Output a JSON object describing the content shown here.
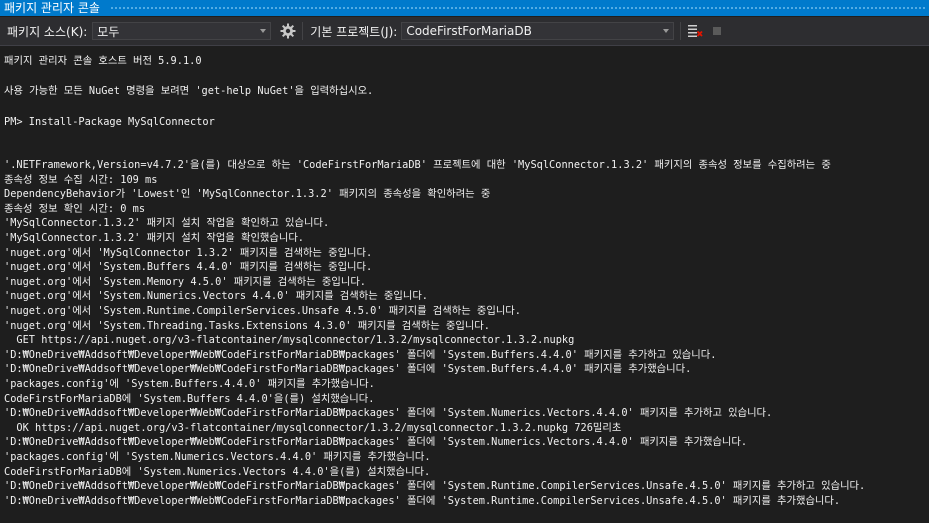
{
  "window": {
    "title": "패키지 관리자 콘솔"
  },
  "toolbar": {
    "source_label": "패키지 소스(K):",
    "source_value": "모두",
    "project_label": "기본 프로젝트(J):",
    "project_value": "CodeFirstForMariaDB"
  },
  "console": {
    "header_line": "패키지 관리자 콘솔 호스트 버전 5.9.1.0",
    "help_line": "사용 가능한 모든 NuGet 명령을 보려면 'get-help NuGet'을 입력하십시오.",
    "prompt_line": "PM> Install-Package MySqlConnector",
    "output_lines": [
      "'.NETFramework,Version=v4.7.2'을(를) 대상으로 하는 'CodeFirstForMariaDB' 프로젝트에 대한 'MySqlConnector.1.3.2' 패키지의 종속성 정보를 수집하려는 중",
      "종속성 정보 수집 시간: 109 ms",
      "DependencyBehavior가 'Lowest'인 'MySqlConnector.1.3.2' 패키지의 종속성을 확인하려는 중",
      "종속성 정보 확인 시간: 0 ms",
      "'MySqlConnector.1.3.2' 패키지 설치 작업을 확인하고 있습니다.",
      "'MySqlConnector.1.3.2' 패키지 설치 작업을 확인했습니다.",
      "'nuget.org'에서 'MySqlConnector 1.3.2' 패키지를 검색하는 중입니다.",
      "'nuget.org'에서 'System.Buffers 4.4.0' 패키지를 검색하는 중입니다.",
      "'nuget.org'에서 'System.Memory 4.5.0' 패키지를 검색하는 중입니다.",
      "'nuget.org'에서 'System.Numerics.Vectors 4.4.0' 패키지를 검색하는 중입니다.",
      "'nuget.org'에서 'System.Runtime.CompilerServices.Unsafe 4.5.0' 패키지를 검색하는 중입니다.",
      "'nuget.org'에서 'System.Threading.Tasks.Extensions 4.3.0' 패키지를 검색하는 중입니다.",
      "  GET https://api.nuget.org/v3-flatcontainer/mysqlconnector/1.3.2/mysqlconnector.1.3.2.nupkg",
      "'D:₩OneDrive₩Addsoft₩Developer₩Web₩CodeFirstForMariaDB₩packages' 폴더에 'System.Buffers.4.4.0' 패키지를 추가하고 있습니다.",
      "'D:₩OneDrive₩Addsoft₩Developer₩Web₩CodeFirstForMariaDB₩packages' 폴더에 'System.Buffers.4.4.0' 패키지를 추가했습니다.",
      "'packages.config'에 'System.Buffers.4.4.0' 패키지를 추가했습니다.",
      "CodeFirstForMariaDB에 'System.Buffers 4.4.0'을(를) 설치했습니다.",
      "'D:₩OneDrive₩Addsoft₩Developer₩Web₩CodeFirstForMariaDB₩packages' 폴더에 'System.Numerics.Vectors.4.4.0' 패키지를 추가하고 있습니다.",
      "  OK https://api.nuget.org/v3-flatcontainer/mysqlconnector/1.3.2/mysqlconnector.1.3.2.nupkg 726밀리초",
      "'D:₩OneDrive₩Addsoft₩Developer₩Web₩CodeFirstForMariaDB₩packages' 폴더에 'System.Numerics.Vectors.4.4.0' 패키지를 추가했습니다.",
      "'packages.config'에 'System.Numerics.Vectors.4.4.0' 패키지를 추가했습니다.",
      "CodeFirstForMariaDB에 'System.Numerics.Vectors 4.4.0'을(를) 설치했습니다.",
      "'D:₩OneDrive₩Addsoft₩Developer₩Web₩CodeFirstForMariaDB₩packages' 폴더에 'System.Runtime.CompilerServices.Unsafe.4.5.0' 패키지를 추가하고 있습니다.",
      "'D:₩OneDrive₩Addsoft₩Developer₩Web₩CodeFirstForMariaDB₩packages' 폴더에 'System.Runtime.CompilerServices.Unsafe.4.5.0' 패키지를 추가했습니다."
    ]
  },
  "icons": {
    "settings": "gear-icon",
    "clear": "clear-console-icon",
    "stop": "stop-icon"
  },
  "colors": {
    "title_bar": "#007acc",
    "toolbar": "#2d2d30",
    "console_bg": "#1e1e1e",
    "text": "#f1f1f1"
  }
}
